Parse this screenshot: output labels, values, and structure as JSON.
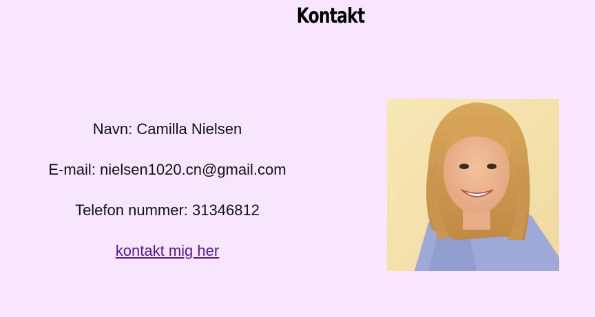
{
  "header": {
    "title": "Kontakt"
  },
  "contact": {
    "name_line": "Navn: Camilla Nielsen",
    "email_line": "E-mail: nielsen1020.cn@gmail.com",
    "phone_line": "Telefon nummer: 31346812",
    "link_label": "kontakt mig her"
  },
  "colors": {
    "background": "#f8e6ff",
    "link": "#551a8b"
  },
  "icons": {
    "photo": "portrait-photo"
  }
}
